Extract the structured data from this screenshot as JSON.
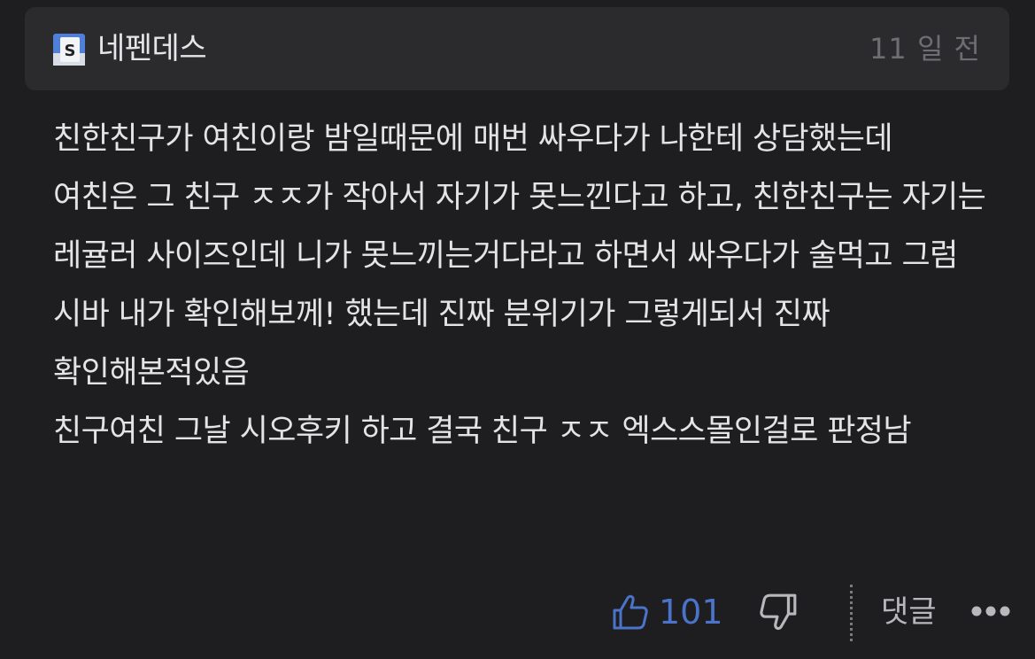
{
  "post": {
    "author": "네펜데스",
    "author_badge_icon": "s-badge-icon",
    "time_ago": "11 일 전",
    "paragraphs": [
      "친한친구가 여친이랑 밤일때문에 매번 싸우다가 나한테 상담했는데",
      "여친은 그 친구 ㅈㅈ가 작아서 자기가 못느낀다고 하고, 친한친구는 자기는 레귤러 사이즈인데 니가 못느끼는거다라고 하면서 싸우다가 술먹고 그럼 시바 내가 확인해보께! 했는데 진짜 분위기가 그렇게되서 진짜 확인해본적있음",
      "친구여친 그날 시오후키 하고 결국 친구 ㅈㅈ 엑스스몰인걸로 판정남"
    ]
  },
  "actions": {
    "like_count": "101",
    "like_icon": "thumbs-up-icon",
    "dislike_icon": "thumbs-down-icon",
    "comment_label": "댓글",
    "more_icon": "more-dots-icon"
  },
  "colors": {
    "background": "#1e1e20",
    "header_background": "#2b2b2e",
    "accent_like": "#4a73c9",
    "text_primary": "#e4e4e6",
    "text_muted": "#6e6e72"
  }
}
